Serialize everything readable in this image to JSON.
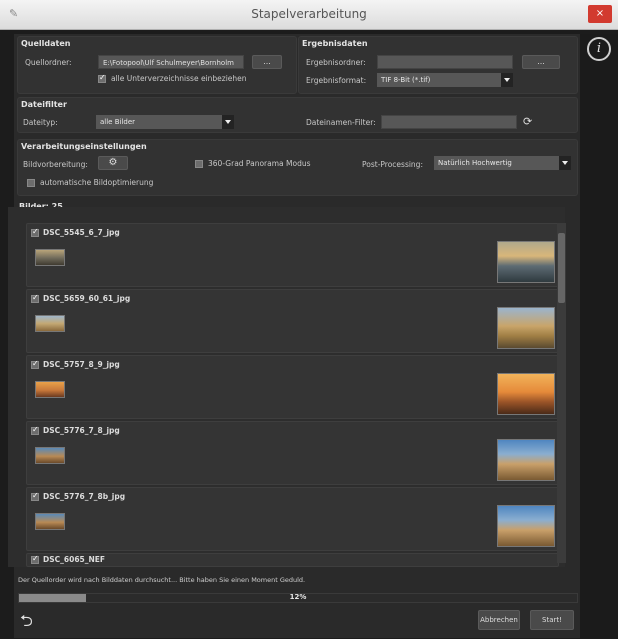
{
  "window": {
    "title": "Stapelverarbeitung",
    "close_label": "×"
  },
  "source": {
    "heading": "Quelldaten",
    "folder_label": "Quellordner:",
    "folder_value": "E:\\Fotopool\\Ulf Schulmeyer\\Bornholm",
    "browse_label": "...",
    "subdirs_label": "alle Unterverzeichnisse einbeziehen",
    "subdirs_checked": true
  },
  "result": {
    "heading": "Ergebnisdaten",
    "folder_label": "Ergebnisordner:",
    "folder_value": "",
    "browse_label": "...",
    "format_label": "Ergebnisformat:",
    "format_value": "TIF 8-Bit (*.tif)"
  },
  "filter": {
    "heading": "Dateifilter",
    "type_label": "Dateityp:",
    "type_value": "alle Bilder",
    "name_label": "Dateinamen-Filter:",
    "name_value": ""
  },
  "processing": {
    "heading": "Verarbeitungseinstellungen",
    "pre_label": "Bildvorbereitung:",
    "panorama_label": "360-Grad Panorama Modus",
    "panorama_checked": false,
    "post_label": "Post-Processing:",
    "post_value": "Natürlich Hochwertig",
    "auto_label": "automatische Bildoptimierung",
    "auto_checked": false
  },
  "images": {
    "heading": "Bilder: 25",
    "items": [
      {
        "name": "DSC_5545_6_7_jpg"
      },
      {
        "name": "DSC_5659_60_61_jpg"
      },
      {
        "name": "DSC_5757_8_9_jpg"
      },
      {
        "name": "DSC_5776_7_8_jpg"
      },
      {
        "name": "DSC_5776_7_8b_jpg"
      },
      {
        "name": "DSC_6065_NEF"
      }
    ]
  },
  "status": {
    "message": "Der Quellorder wird nach Bilddaten durchsucht... Bitte haben Sie einen Moment Geduld.",
    "progress_percent": 12,
    "progress_label": "12%"
  },
  "footer": {
    "cancel_label": "Abbrechen",
    "start_label": "Start!"
  },
  "icons": [
    "app-icon",
    "info-icon",
    "undo-icon",
    "refresh-icon",
    "gear-icon"
  ]
}
